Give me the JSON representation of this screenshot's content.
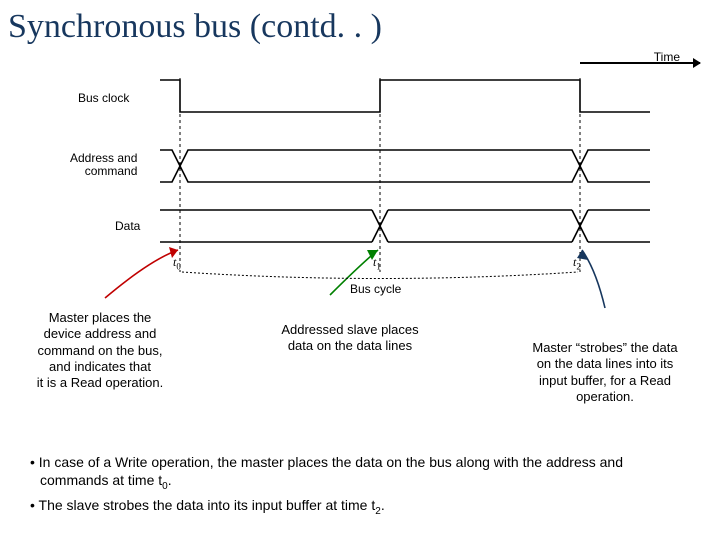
{
  "title": "Synchronous bus (contd. . )",
  "time_label": "Time",
  "signals": {
    "bus_clock": "Bus clock",
    "addr_cmd_line1": "Address and",
    "addr_cmd_line2": "command",
    "data": "Data"
  },
  "ticks": {
    "t0": "t",
    "t0_sub": "0",
    "t1": "t",
    "t1_sub": "1",
    "t2": "t",
    "t2_sub": "2"
  },
  "bus_cycle": "Bus cycle",
  "callouts": {
    "c1_l1": "Master places the",
    "c1_l2": "device address and",
    "c1_l3": "command on the bus,",
    "c1_l4": "and indicates that",
    "c1_l5": "it is a Read operation.",
    "c2_l1": "Addressed slave places",
    "c2_l2": "data on the data lines",
    "c3_l1": "Master “strobes” the data",
    "c3_l2": "on the data lines into its",
    "c3_l3": "input buffer, for a Read",
    "c3_l4": "operation."
  },
  "bullets": {
    "b1_pre": "• In case of a Write operation, the master places the data on the bus along with the address and commands at time t",
    "b1_sub": "0",
    "b1_post": ".",
    "b2_pre": "• The slave strobes the data into its input buffer at time t",
    "b2_sub": "2",
    "b2_post": "."
  }
}
